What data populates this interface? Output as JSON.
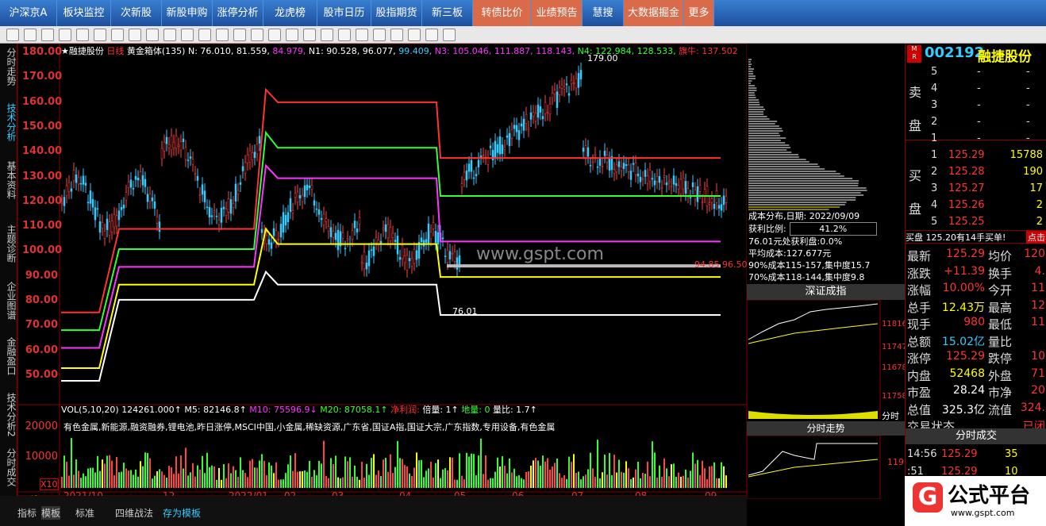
{
  "menu": [
    "沪深京A",
    "板块监控",
    "次新股",
    "新股申购",
    "涨停分析",
    "龙虎榜",
    "股市日历",
    "股指期货",
    "新三板",
    "转债比价",
    "业绩预告",
    "慧搜",
    "大数据掘金",
    "更多"
  ],
  "left_tabs": [
    "分时走势",
    "技术分析",
    "基本资料",
    "主题诊断",
    "企业图谱",
    "金融盈口",
    "技术分析2",
    "分时成交"
  ],
  "header": {
    "star": "★",
    "name": "融捷股份",
    "period": "日线",
    "indicator": "黄金箱体(135)",
    "n": "N: 76.010, 81.559,",
    "n2": "84.979,",
    "n1": "N1: 90.528, 96.077,",
    "n3a": "99.409,",
    "n3": "N3: 105.046, 111.887,",
    "n3b": "118.143,",
    "n4": "N4: 122.984, 128.533,",
    "tag": "旗牛: 137.502"
  },
  "y_axis": [
    "180.00",
    "170.00",
    "160.00",
    "150.00",
    "140.00",
    "130.00",
    "120.00",
    "110.00",
    "100.00",
    "90.00",
    "80.00",
    "70.00",
    "60.00",
    "50.00"
  ],
  "annotations": {
    "high": "179.00",
    "low": "76.01",
    "mid": "94.85 96.50",
    "wm": "www.gspt.com"
  },
  "vol": {
    "title": "VOL(5,10,20)",
    "v": "124261.000↑",
    "m5": "M5: 82146.8↑",
    "m10": "M10: 75596.9↓",
    "m20": "M20: 87058.1↑",
    "net": "净利润:",
    "bei": "倍量: 1↑",
    "di": "地量: 0",
    "lb": "量比: 1.7↑",
    "concepts": "有色金属,新能源,融资融券,锂电池,昨日涨停,MSCI中国,小金属,稀缺资源,广东省,国证A指,国证大宗,广东指数,专用设备,有色金属",
    "y": [
      "20000",
      "10000"
    ],
    "x10": "X10"
  },
  "x_axis": [
    "2021/10",
    "12",
    "2022/01",
    "02",
    "03",
    "04",
    "05",
    "06",
    "07",
    "08",
    "09"
  ],
  "period_label": "日线▲",
  "bottom_tabs": [
    "指标",
    "模板",
    "标准",
    "四维战法",
    "存为模板"
  ],
  "chip": {
    "date": "成本分布,日期: 2022/09/09",
    "ratio_label": "获利比例:",
    "ratio": "41.2%",
    "profit": "76.01元处获利盘:0.0%",
    "avg": "平均成本:127.677元",
    "c90": "90%成本115-157,集中度15.7",
    "c70": "70%成本118-144,集中度9.8"
  },
  "index_title": "深证成指",
  "index_y": [
    "11816",
    "11747",
    "11678",
    "11758"
  ],
  "fenshi_tab": "分时",
  "fenshi_title": "分时走势",
  "fenshi_y": "119.6",
  "stock": {
    "code": "002192",
    "name": "融捷股份",
    "sell_label": [
      "卖",
      "盘"
    ],
    "buy_label": [
      "买",
      "盘"
    ],
    "sell": [
      {
        "n": "5",
        "p": "-",
        "v": "-"
      },
      {
        "n": "4",
        "p": "-",
        "v": "-"
      },
      {
        "n": "3",
        "p": "-",
        "v": "-"
      },
      {
        "n": "2",
        "p": "-",
        "v": "-"
      },
      {
        "n": "1",
        "p": "-",
        "v": "-"
      }
    ],
    "buy": [
      {
        "n": "1",
        "p": "125.29",
        "v": "15788"
      },
      {
        "n": "2",
        "p": "125.28",
        "v": "190"
      },
      {
        "n": "3",
        "p": "125.27",
        "v": "17"
      },
      {
        "n": "4",
        "p": "125.26",
        "v": "2"
      },
      {
        "n": "5",
        "p": "125.25",
        "v": "2"
      }
    ],
    "buy_note": "买盘 125.20有14手买单!",
    "click": "点击",
    "quotes": [
      [
        "最新",
        "125.29",
        "均价",
        "120"
      ],
      [
        "涨跌",
        "+11.39",
        "换手",
        "4."
      ],
      [
        "涨幅",
        "10.00%",
        "今开",
        "11"
      ],
      [
        "总手",
        "12.43万",
        "最高",
        "12"
      ],
      [
        "现手",
        "980",
        "最低",
        "11"
      ],
      [
        "总额",
        "15.02亿",
        "量比",
        ""
      ],
      [
        "涨停",
        "125.29",
        "跌停",
        "10"
      ],
      [
        "内盘",
        "52468",
        "外盘",
        "71"
      ],
      [
        "市盈",
        "28.24",
        "市净",
        "20"
      ],
      [
        "总值",
        "325.3亿",
        "流值",
        "324."
      ],
      [
        "交易状态",
        "",
        "",
        "已闭"
      ]
    ],
    "trades_title": "分时成交",
    "trades": [
      [
        "14:56",
        "125.29",
        "35"
      ],
      [
        ":51",
        "125.29",
        "10"
      ]
    ]
  },
  "logo": "公式平台",
  "logo_url": "www.gspt.com",
  "chart_data": {
    "type": "line",
    "y_range": [
      45,
      182
    ],
    "series": [
      {
        "name": "N",
        "values": [
          76.01,
          81.559,
          84.979
        ]
      },
      {
        "name": "N1",
        "values": [
          90.528,
          96.077,
          99.409
        ]
      },
      {
        "name": "N3",
        "values": [
          105.046,
          111.887,
          118.143
        ]
      },
      {
        "name": "N4",
        "values": [
          122.984,
          128.533
        ]
      }
    ]
  }
}
